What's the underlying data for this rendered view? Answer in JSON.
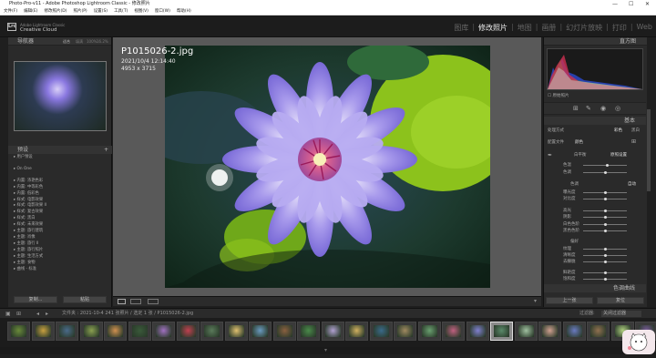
{
  "window": {
    "title": "Photo-Pro-v11 - Adobe Photoshop Lightroom Classic - 修改照片"
  },
  "menu": [
    "文件(F)",
    "编辑(E)",
    "修改照片(D)",
    "照片(P)",
    "设置(S)",
    "工具(T)",
    "视图(V)",
    "窗口(W)",
    "帮助(H)"
  ],
  "identity": {
    "logo": "Lrc",
    "brand_top": "Adobe Lightroom Classic",
    "brand_bottom": "Creative Cloud"
  },
  "modules": [
    {
      "label": "图库",
      "active": false
    },
    {
      "label": "修改照片",
      "active": true
    },
    {
      "label": "地图",
      "active": false
    },
    {
      "label": "画册",
      "active": false
    },
    {
      "label": "幻灯片放映",
      "active": false
    },
    {
      "label": "打印",
      "active": false
    },
    {
      "label": "Web",
      "active": false
    }
  ],
  "left": {
    "navigator": "导航器",
    "zoom": {
      "fit": "适合",
      "fill": "填满",
      "z100": "100%",
      "z": "16.2%"
    },
    "presets_title": "预设",
    "presets": [
      "用户预设",
      "On One",
      "内置: 浓艳色彩",
      "内置: 中等彩色",
      "内置: 低彩色",
      "样式: 电影效果",
      "样式: 电影效果 II",
      "样式: 复古效果",
      "样式: 黑白",
      "样式: 未来效果",
      "主题: 旅行建筑",
      "主题: 肖像",
      "主题: 旅行 II",
      "主题: 旅行照片",
      "主题: 生活方式",
      "主题: 食物",
      "曲线 - 标准"
    ],
    "copy_btn": "复制...",
    "paste_btn": "粘贴"
  },
  "image": {
    "filename": "P1015026-2.jpg",
    "datetime": "2021/10/4 12:14:40",
    "dimensions": "4953 x 3715"
  },
  "right": {
    "histogram_title": "直方图",
    "original_photo": "原始照片",
    "basic_title": "基本",
    "profile_label": "处理方式",
    "color": "彩色",
    "bw": "黑白",
    "profile_name": "配置文件",
    "profile_value": "颜色",
    "wb_label": "白平衡",
    "wb_value": "原照设置",
    "temp": "色温",
    "tint": "色调",
    "tone_label": "色调",
    "auto": "自动",
    "exposure": "曝光度",
    "contrast": "对比度",
    "highlights": "高光",
    "shadows": "阴影",
    "whites": "白色色阶",
    "blacks": "黑色色阶",
    "presence": "偏好",
    "texture": "纹理",
    "clarity": "清晰度",
    "dehaze": "去朦胧",
    "vibrance": "鲜艳度",
    "saturation": "饱和度",
    "tone_curve": "色调曲线",
    "prev_btn": "上一张",
    "reset_btn": "复位"
  },
  "filmstrip": {
    "breadcrumb": "文件夹 : 2021-10-4   241 张照片 / 选定 1 张 / P1015026-2.jpg",
    "filter_label": "过滤器:",
    "filter_value": "关闭过滤器",
    "thumbs": [
      "#6a8a3a",
      "#c8a040",
      "#4a6a8a",
      "#8aa050",
      "#d09050",
      "#3a5a3a",
      "#a070c0",
      "#c04050",
      "#5a7a5a",
      "#e0c070",
      "#6a9ac0",
      "#8a6040",
      "#4a8a4a",
      "#b0a0d0",
      "#d0b060",
      "#3a6a8a",
      "#a08a60",
      "#6aa070",
      "#c06080",
      "#8080d0",
      "#5a8a6a",
      "#a0c0a0",
      "#d0a090",
      "#6a7ac0",
      "#907050",
      "#b0d080",
      "#7a5a9a"
    ],
    "selected_index": 20
  },
  "colors": {
    "accent": "#eeeeee",
    "panel": "#2a2a2a",
    "bg": "#595959"
  }
}
